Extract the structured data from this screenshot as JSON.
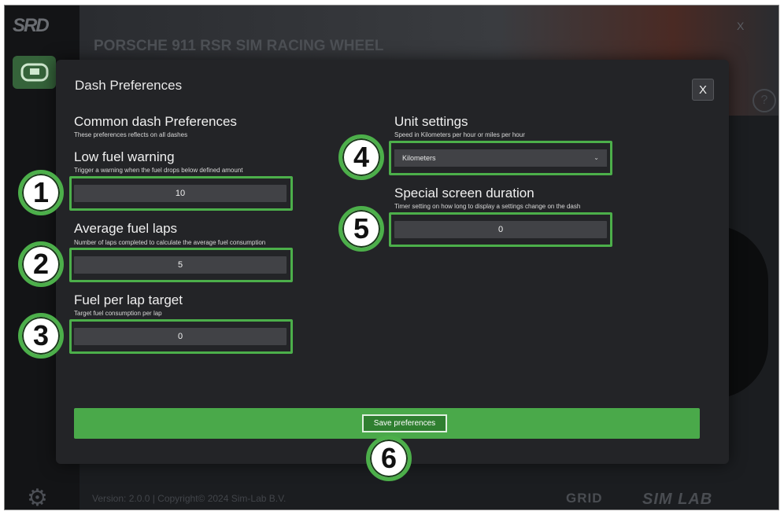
{
  "app": {
    "title": "PORSCHE 911 RSR SIM RACING WHEEL",
    "close_label": "X",
    "help_label": "?",
    "logo_text": "SRD",
    "settings_icon": "gear-icon",
    "nav_icon": "steering-wheel-icon",
    "footer_version": "Version: 2.0.0 | Copyright© 2024 Sim-Lab B.V.",
    "footer_logos": [
      "GRID",
      "SIM LAB"
    ]
  },
  "modal": {
    "title": "Dash Preferences",
    "close_label": "X",
    "common": {
      "heading": "Common dash Preferences",
      "description": "These preferences reflects on all dashes"
    },
    "low_fuel": {
      "label": "Low fuel warning",
      "description": "Trigger a warning when the fuel drops below defined amount",
      "value": "10"
    },
    "avg_fuel_laps": {
      "label": "Average fuel laps",
      "description": "Number of laps completed to calculate the average fuel consumption",
      "value": "5"
    },
    "fuel_per_lap": {
      "label": "Fuel per lap target",
      "description": "Target fuel consumption per lap",
      "value": "0"
    },
    "units": {
      "label": "Unit settings",
      "description": "Speed in Kilometers per hour or miles per hour",
      "selected": "Kilometers"
    },
    "special_screen": {
      "label": "Special screen duration",
      "description": "Timer setting on how long to display a settings change on the dash",
      "value": "0"
    },
    "save_label": "Save preferences"
  },
  "callouts": [
    "1",
    "2",
    "3",
    "4",
    "5",
    "6"
  ],
  "colors": {
    "highlight": "#4caf4a",
    "save_bar": "#4aa94a",
    "modal_bg": "#232427"
  }
}
